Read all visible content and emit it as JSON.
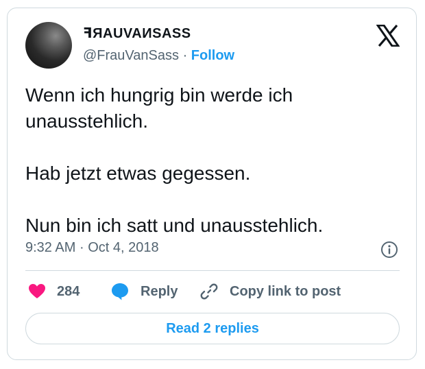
{
  "author": {
    "display_name": "ꟻЯAUVAИSASS",
    "handle": "@FrauVanSass",
    "separator": "·",
    "follow_label": "Follow"
  },
  "tweet": {
    "paragraphs": [
      "Wenn ich hungrig bin werde ich unausstehlich.",
      "Hab jetzt etwas gegessen.",
      "Nun bin ich satt und unausstehlich."
    ],
    "time": "9:32 AM",
    "separator": "·",
    "date": "Oct 4, 2018"
  },
  "actions": {
    "like_count": "284",
    "reply_label": "Reply",
    "copy_link_label": "Copy link to post"
  },
  "footer": {
    "read_replies_label": "Read 2 replies"
  },
  "icons": {
    "brand": "x-logo-icon",
    "info": "info-icon",
    "like": "heart-icon",
    "reply": "speech-bubble-icon",
    "copy": "link-icon"
  },
  "colors": {
    "accent": "#1d9bf0",
    "like": "#f91880",
    "text": "#0f1419",
    "muted": "#536471",
    "border": "#cfd9de"
  }
}
